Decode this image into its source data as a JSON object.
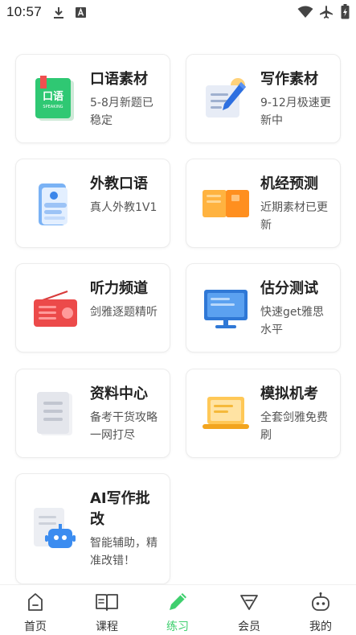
{
  "status_bar": {
    "time": "10:57"
  },
  "cards": [
    {
      "title": "口语素材",
      "desc": "5-8月新题已稳定",
      "icon": "speaking-book-icon",
      "badge_title": "口语",
      "badge_sub": "SPEAKING"
    },
    {
      "title": "写作素材",
      "desc": "9-12月极速更新中",
      "icon": "writing-pen-icon"
    },
    {
      "title": "外教口语",
      "desc": "真人外教1V1",
      "icon": "phone-tutor-icon"
    },
    {
      "title": "机经预测",
      "desc": "近期素材已更新",
      "icon": "open-book-icon"
    },
    {
      "title": "听力频道",
      "desc": "剑雅逐题精听",
      "icon": "radio-icon"
    },
    {
      "title": "估分测试",
      "desc": "快速get雅思水平",
      "icon": "monitor-icon"
    },
    {
      "title": "资料中心",
      "desc": "备考干货攻略一网打尽",
      "icon": "document-icon"
    },
    {
      "title": "模拟机考",
      "desc": "全套剑雅免费刷",
      "icon": "laptop-icon"
    },
    {
      "title": "AI写作批改",
      "desc": "智能辅助，精准改错！",
      "icon": "ai-robot-icon"
    }
  ],
  "bottom_nav": [
    {
      "label": "首页",
      "icon": "home-icon",
      "active": false
    },
    {
      "label": "课程",
      "icon": "course-book-icon",
      "active": false
    },
    {
      "label": "练习",
      "icon": "practice-pen-icon",
      "active": true
    },
    {
      "label": "会员",
      "icon": "member-diamond-icon",
      "active": false
    },
    {
      "label": "我的",
      "icon": "profile-robot-icon",
      "active": false
    }
  ],
  "colors": {
    "accent": "#3fcf6e",
    "card_border": "#ececec"
  }
}
